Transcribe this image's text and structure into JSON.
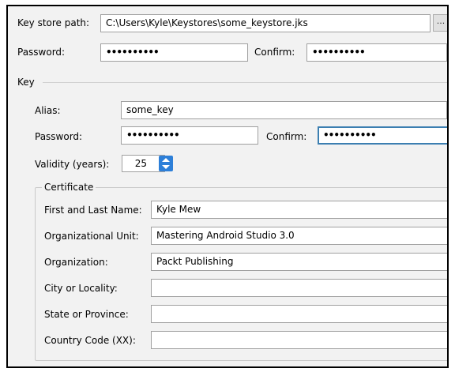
{
  "keystore": {
    "path_label": "Key store path:",
    "path_value": "C:\\Users\\Kyle\\Keystores\\some_keystore.jks",
    "browse_label": "...",
    "password_label": "Password:",
    "password_value": "••••••••••",
    "confirm_label": "Confirm:",
    "confirm_value": "••••••••••"
  },
  "key": {
    "section_label": "Key",
    "alias_label": "Alias:",
    "alias_value": "some_key",
    "password_label": "Password:",
    "password_value": "••••••••••",
    "confirm_label": "Confirm:",
    "confirm_value": "••••••••••",
    "validity_label": "Validity (years):",
    "validity_value": "25"
  },
  "certificate": {
    "group_label": "Certificate",
    "fields": [
      {
        "label": "First and Last Name:",
        "value": "Kyle Mew"
      },
      {
        "label": "Organizational Unit:",
        "value": "Mastering Android Studio 3.0"
      },
      {
        "label": "Organization:",
        "value": "Packt Publishing"
      },
      {
        "label": "City or Locality:",
        "value": ""
      },
      {
        "label": "State or Province:",
        "value": ""
      },
      {
        "label": "Country Code (XX):",
        "value": ""
      }
    ]
  }
}
